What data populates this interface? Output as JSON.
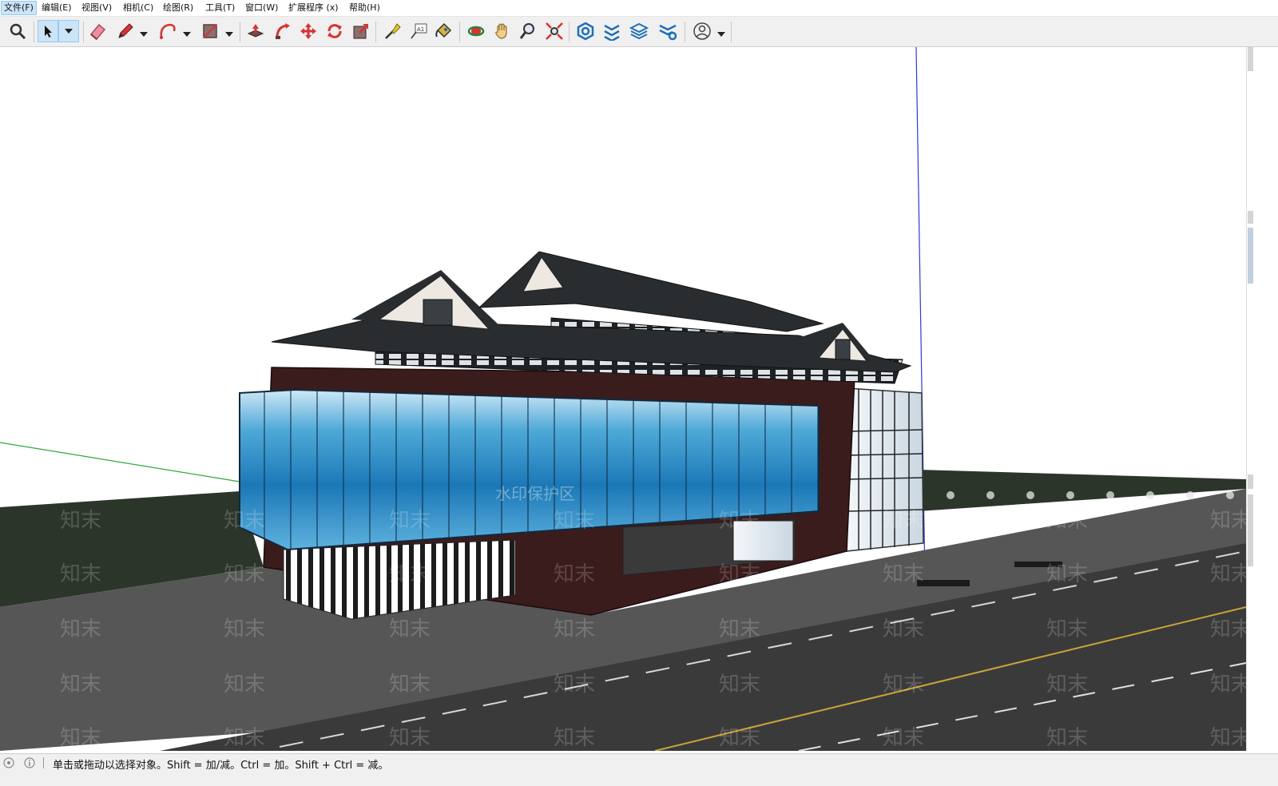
{
  "menubar": {
    "items": [
      "文件(F)",
      "编辑(E)",
      "视图(V)",
      "相机(C)",
      "绘图(R)",
      "工具(T)",
      "窗口(W)",
      "扩展程序 (x)",
      "帮助(H)"
    ]
  },
  "toolbar": {
    "tools": [
      {
        "name": "zoom-window",
        "icon": "magnifier-icon"
      },
      {
        "name": "select",
        "icon": "arrow-cursor-icon",
        "selected": true
      },
      {
        "name": "eraser",
        "icon": "eraser-icon"
      },
      {
        "name": "line",
        "icon": "pencil-icon"
      },
      {
        "name": "arc",
        "icon": "arc-icon"
      },
      {
        "name": "rectangle",
        "icon": "rectangle-icon"
      },
      {
        "name": "push-pull",
        "icon": "push-pull-icon"
      },
      {
        "name": "follow-me",
        "icon": "follow-me-icon"
      },
      {
        "name": "move",
        "icon": "move-arrows-icon"
      },
      {
        "name": "rotate",
        "icon": "rotate-icon"
      },
      {
        "name": "scale",
        "icon": "scale-icon"
      },
      {
        "name": "tape-measure",
        "icon": "tape-measure-icon"
      },
      {
        "name": "text",
        "icon": "text-label-icon"
      },
      {
        "name": "paint-bucket",
        "icon": "paint-bucket-icon"
      },
      {
        "name": "orbit",
        "icon": "orbit-icon"
      },
      {
        "name": "pan",
        "icon": "hand-icon"
      },
      {
        "name": "zoom",
        "icon": "zoom-icon"
      },
      {
        "name": "zoom-extents",
        "icon": "zoom-extents-icon"
      },
      {
        "name": "3d-warehouse",
        "icon": "warehouse-icon"
      },
      {
        "name": "extension-warehouse",
        "icon": "extension-icon"
      },
      {
        "name": "layout",
        "icon": "layers-icon"
      },
      {
        "name": "extension-manager",
        "icon": "gear-stack-icon"
      },
      {
        "name": "account",
        "icon": "user-icon"
      }
    ]
  },
  "viewport": {
    "watermark_small": "知末",
    "watermark_center": "水印保护区",
    "colors": {
      "sky": "#ffffff",
      "grass": "#2c352a",
      "road": "#3b3b3b",
      "sidewalk": "#575757",
      "facade_dark": "#3b1c1c",
      "roof": "#2a2d30",
      "glass_blue": "#2f8fc8",
      "axis_green": "#2fa83a",
      "axis_blue": "#2a3bd6"
    }
  },
  "statusbar": {
    "text": "单击或拖动以选择对象。Shift = 加/减。Ctrl = 加。Shift + Ctrl = 减。"
  }
}
